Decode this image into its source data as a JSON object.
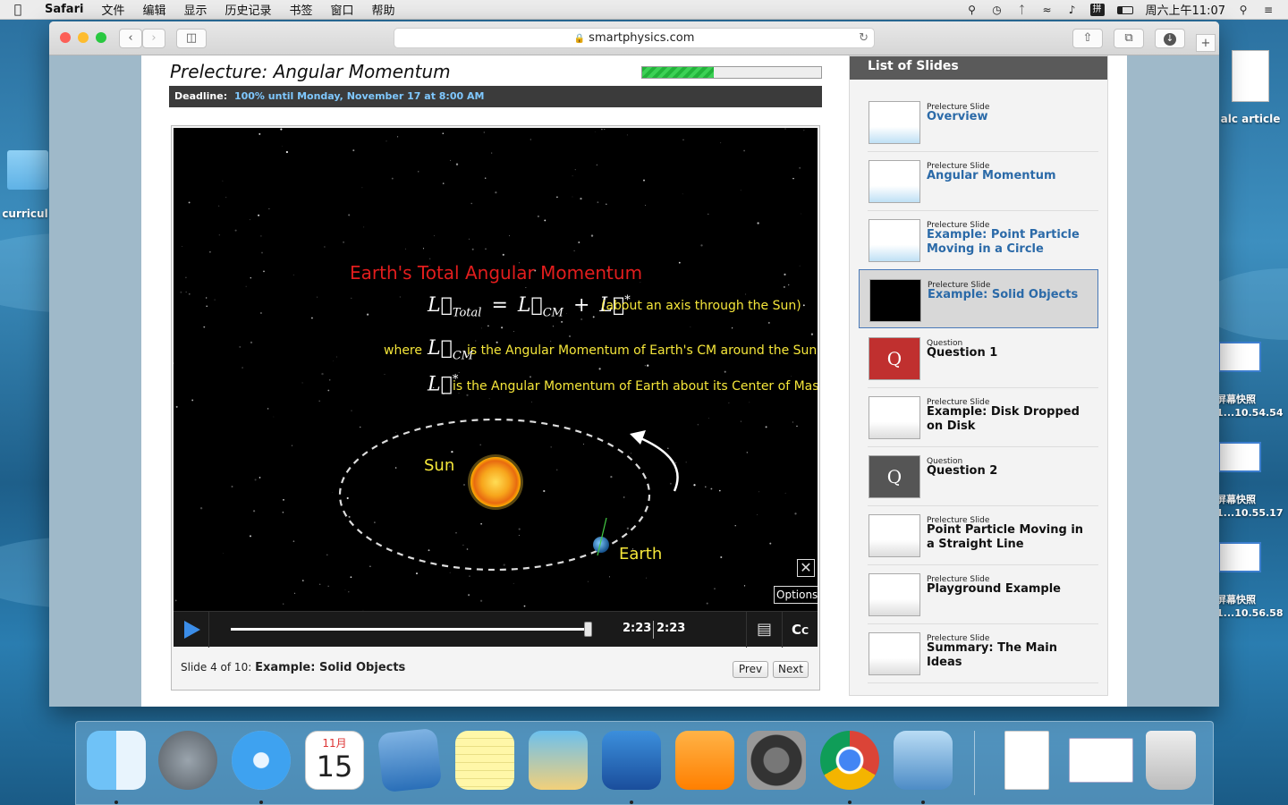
{
  "menubar": {
    "app": "Safari",
    "items": [
      "文件",
      "编辑",
      "显示",
      "历史记录",
      "书签",
      "窗口",
      "帮助"
    ],
    "clock": "周六上午11:07"
  },
  "desktop": {
    "left_folder": "curricul",
    "right_doc": "alc article",
    "screenshots": [
      {
        "label1": "屏幕快照",
        "label2": "1...10.54.54"
      },
      {
        "label1": "屏幕快照",
        "label2": "1...10.55.17"
      },
      {
        "label1": "屏幕快照",
        "label2": "1...10.56.58"
      }
    ]
  },
  "browser": {
    "url": "smartphysics.com"
  },
  "lecture": {
    "title": "Prelecture: Angular Momentum",
    "progress_fraction": 0.4,
    "deadline_label": "Deadline:",
    "deadline_value": "100% until Monday, November 17 at 8:00 AM"
  },
  "slide": {
    "heading": "Earth's Total Angular Momentum",
    "eq_note": "(about an axis through the Sun)",
    "where": "where",
    "lcm_text": "is the Angular Momentum of Earth's CM around the Sun",
    "lstar_text": "is the Angular Momentum of Earth about its Center of Mass",
    "sun_label": "Sun",
    "earth_label": "Earth",
    "options": "Options"
  },
  "player": {
    "current_time": "2:23",
    "total_time": "2:23",
    "progress_fraction": 1.0,
    "caption_prefix": "Slide 4 of 10:",
    "caption_title": "Example: Solid Objects",
    "prev": "Prev",
    "next": "Next"
  },
  "slide_list": {
    "header": "List of Slides",
    "items": [
      {
        "type": "Prelecture Slide",
        "title": "Overview"
      },
      {
        "type": "Prelecture Slide",
        "title": "Angular Momentum"
      },
      {
        "type": "Prelecture Slide",
        "title": "Example: Point Particle Moving in a Circle"
      },
      {
        "type": "Prelecture Slide",
        "title": "Example: Solid Objects"
      },
      {
        "type": "Question",
        "title": "Question 1"
      },
      {
        "type": "Prelecture Slide",
        "title": "Example: Disk Dropped on Disk"
      },
      {
        "type": "Question",
        "title": "Question 2"
      },
      {
        "type": "Prelecture Slide",
        "title": "Point Particle Moving in a Straight Line"
      },
      {
        "type": "Prelecture Slide",
        "title": "Playground Example"
      },
      {
        "type": "Prelecture Slide",
        "title": "Summary: The Main Ideas"
      }
    ]
  },
  "dock": {
    "calendar_month": "11月",
    "calendar_day": "15"
  }
}
